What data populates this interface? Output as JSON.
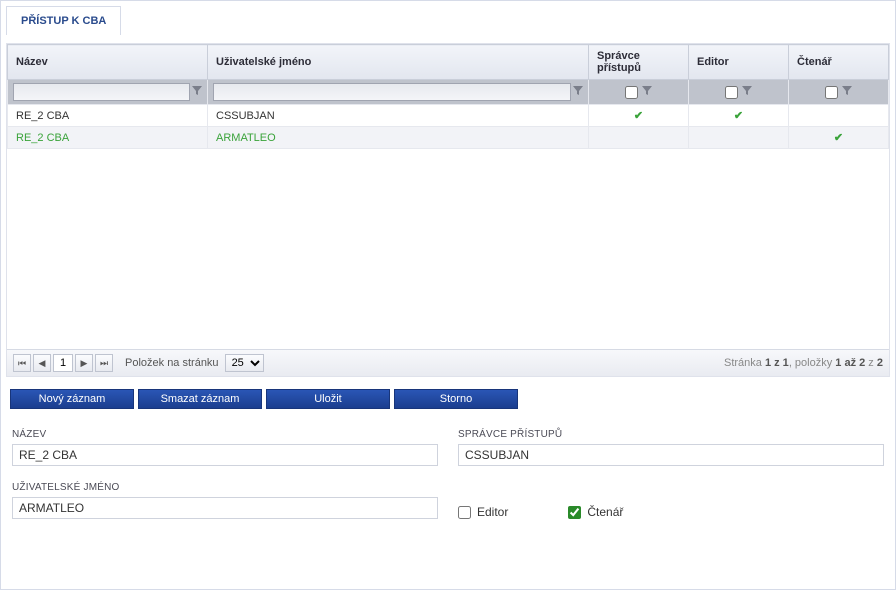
{
  "tab_title": "PŘÍSTUP K CBA",
  "columns": {
    "name": "Název",
    "username": "Uživatelské jméno",
    "admin": "Správce přístupů",
    "editor": "Editor",
    "reader": "Čtenář"
  },
  "rows": [
    {
      "name": "RE_2 CBA",
      "username": "CSSUBJAN",
      "admin": true,
      "editor": true,
      "reader": false,
      "selected": false
    },
    {
      "name": "RE_2 CBA",
      "username": "ARMATLEO",
      "admin": false,
      "editor": false,
      "reader": true,
      "selected": true
    }
  ],
  "pager": {
    "page": "1",
    "items_per_page_label": "Položek na stránku",
    "items_per_page": "25",
    "info_prefix": "Stránka ",
    "info_page": "1 z 1",
    "info_mid": ", položky ",
    "info_range": "1 až 2",
    "info_suffix": " z ",
    "info_total": "2"
  },
  "buttons": {
    "new": "Nový záznam",
    "delete": "Smazat záznam",
    "save": "Uložit",
    "cancel": "Storno"
  },
  "form": {
    "name_label": "NÁZEV",
    "name_value": "RE_2 CBA",
    "admin_label": "SPRÁVCE PŘÍSTUPŮ",
    "admin_value": "CSSUBJAN",
    "username_label": "UŽIVATELSKÉ JMÉNO",
    "username_value": "ARMATLEO",
    "editor_label": "Editor",
    "editor_checked": false,
    "reader_label": "Čtenář",
    "reader_checked": true
  }
}
